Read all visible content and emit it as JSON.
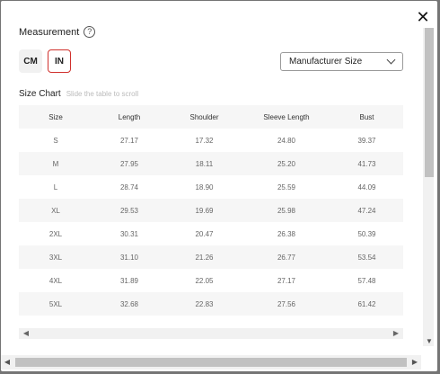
{
  "header": {
    "title": "Measurement"
  },
  "units": [
    {
      "label": "CM",
      "active": false
    },
    {
      "label": "IN",
      "active": true
    }
  ],
  "size_selector": {
    "value": "Manufacturer Size"
  },
  "size_chart": {
    "title": "Size Chart",
    "hint": "Slide the table to scroll",
    "columns": [
      "Size",
      "Length",
      "Shoulder",
      "Sleeve Length",
      "Bust"
    ],
    "rows": [
      [
        "S",
        "27.17",
        "17.32",
        "24.80",
        "39.37"
      ],
      [
        "M",
        "27.95",
        "18.11",
        "25.20",
        "41.73"
      ],
      [
        "L",
        "28.74",
        "18.90",
        "25.59",
        "44.09"
      ],
      [
        "XL",
        "29.53",
        "19.69",
        "25.98",
        "47.24"
      ],
      [
        "2XL",
        "30.31",
        "20.47",
        "26.38",
        "50.39"
      ],
      [
        "3XL",
        "31.10",
        "21.26",
        "26.77",
        "53.54"
      ],
      [
        "4XL",
        "31.89",
        "22.05",
        "27.17",
        "57.48"
      ],
      [
        "5XL",
        "32.68",
        "22.83",
        "27.56",
        "61.42"
      ]
    ]
  },
  "colors": {
    "accent": "#d0312d",
    "stripe": "#f6f6f6"
  }
}
